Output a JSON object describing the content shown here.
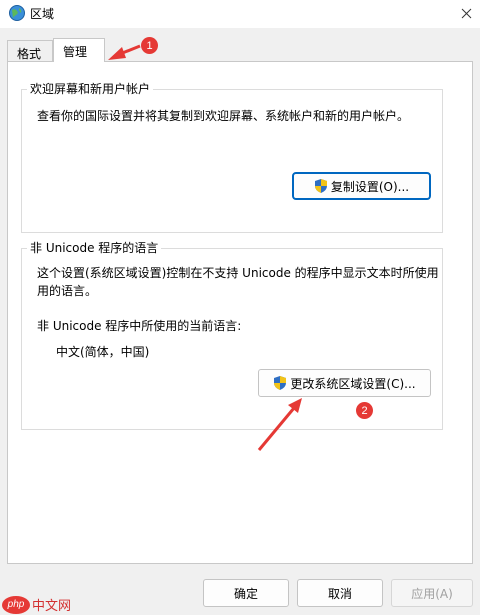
{
  "window": {
    "title": "区域",
    "close_icon": "close-icon",
    "app_icon": "globe-icon"
  },
  "tabs": [
    {
      "label": "格式",
      "selected": false
    },
    {
      "label": "管理",
      "selected": true
    }
  ],
  "welcome_group": {
    "title": "欢迎屏幕和新用户帐户",
    "description": "查看你的国际设置并将其复制到欢迎屏幕、系统帐户和新的用户帐户。",
    "button_label": "复制设置(O)...",
    "button_icon": "shield-icon"
  },
  "unicode_group": {
    "title": "非 Unicode 程序的语言",
    "description_line1": "这个设置(系统区域设置)控制在不支持 Unicode 的程序中显示文本时所使用",
    "description_line2": "用的语言。",
    "current_label": "非 Unicode 程序中所使用的当前语言:",
    "current_value": "中文(简体，中国)",
    "button_label": "更改系统区域设置(C)...",
    "button_icon": "shield-icon"
  },
  "footer": {
    "ok_label": "确定",
    "cancel_label": "取消",
    "apply_label": "应用(A)"
  },
  "annotations": {
    "marker_1": "1",
    "marker_2": "2",
    "accent_color": "#e53935"
  },
  "watermark": {
    "logo_text": "php",
    "site_text": "中文网"
  },
  "colors": {
    "focus_border": "#0067c0",
    "panel_bg": "#ffffff",
    "window_bg": "#f0f0f0"
  }
}
